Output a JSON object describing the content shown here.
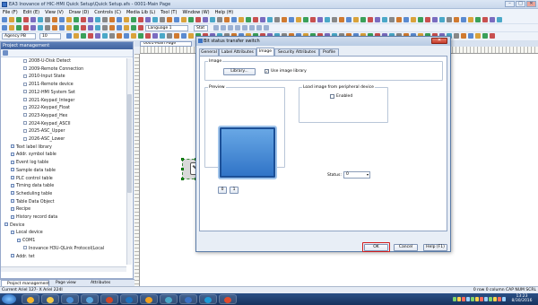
{
  "window": {
    "title": "EA3 Inovance of HIC-HMI Quick Setup\\Quick Setup.afs - 0001-Main Page",
    "min": "–",
    "max": "□",
    "close": "✕"
  },
  "menu": [
    "File (F)",
    "Edit (E)",
    "View (V)",
    "Draw (D)",
    "Controls (C)",
    "Media Lib (L)",
    "Tool (T)",
    "Window (W)",
    "Help (H)"
  ],
  "toolbar": {
    "language": "Language 1",
    "state": "Stat",
    "agency": "Agency PB",
    "zoom": "10"
  },
  "project": {
    "header": "Project management",
    "tree": [
      {
        "label": "2008-U-Disk Detect",
        "indent": 3
      },
      {
        "label": "2009-Remote Connection",
        "indent": 3
      },
      {
        "label": "2010-Input State",
        "indent": 3
      },
      {
        "label": "2011-Remote device",
        "indent": 3
      },
      {
        "label": "2012-HMI System Set",
        "indent": 3
      },
      {
        "label": "2021-Keypad_Integer",
        "indent": 3
      },
      {
        "label": "2022-Keypad_Float",
        "indent": 3
      },
      {
        "label": "2023-Keypad_Hex",
        "indent": 3
      },
      {
        "label": "2024-Keypad_ASCII",
        "indent": 3
      },
      {
        "label": "2025-ASC_Upper",
        "indent": 3
      },
      {
        "label": "2026-ASC_Lower",
        "indent": 3
      },
      {
        "label": "Text label library",
        "indent": 1
      },
      {
        "label": "Addr. symbol table",
        "indent": 1
      },
      {
        "label": "Event log table",
        "indent": 1
      },
      {
        "label": "Sample data table",
        "indent": 1
      },
      {
        "label": "PLC control table",
        "indent": 1
      },
      {
        "label": "Timing data table",
        "indent": 1
      },
      {
        "label": "Scheduling table",
        "indent": 1
      },
      {
        "label": "Table Data Object",
        "indent": 1
      },
      {
        "label": "Recipe",
        "indent": 1
      },
      {
        "label": "History record data",
        "indent": 1
      },
      {
        "label": "Device",
        "indent": 0
      },
      {
        "label": "Local device",
        "indent": 1
      },
      {
        "label": "COM1",
        "indent": 2
      },
      {
        "label": "Inovance H3U-QLink Protocol(Local",
        "indent": 3
      },
      {
        "label": "Addr. tet",
        "indent": 1
      }
    ]
  },
  "bottom_tabs": [
    "Project management",
    "Page view",
    "Attributes"
  ],
  "editor": {
    "tab": "0001-Main Page"
  },
  "dialog": {
    "title": "Bit status transfer switch",
    "close": "✕",
    "tabs": [
      "General",
      "Label Attributes",
      "Image",
      "Security Attributes",
      "Profile"
    ],
    "active_tab": "Image",
    "image_group": "Image",
    "library_button": "Library...",
    "use_image_library_label": "Use image library",
    "use_image_library_checked": true,
    "preview_label": "Preview",
    "load_group": "Load image from peripheral device",
    "enabled_label": "Enabled",
    "enabled_checked": false,
    "state_btn_0": "0",
    "state_btn_1": "1",
    "status_label": "Status:",
    "status_value": "0",
    "ok": "OK",
    "cancel": "Cancel",
    "help": "Help (F1)"
  },
  "status_bar": {
    "left": "Current Ariel  127- X Ariel  224I",
    "right": "0 row 0 column  CAP  NUM  SCRL"
  },
  "clock": {
    "time": "13:23",
    "date": "8/30/2016"
  },
  "colors": {
    "accent": "#3b72c4",
    "ok_highlight": "#d41d1d",
    "preview_blue": "#2e72c6"
  }
}
